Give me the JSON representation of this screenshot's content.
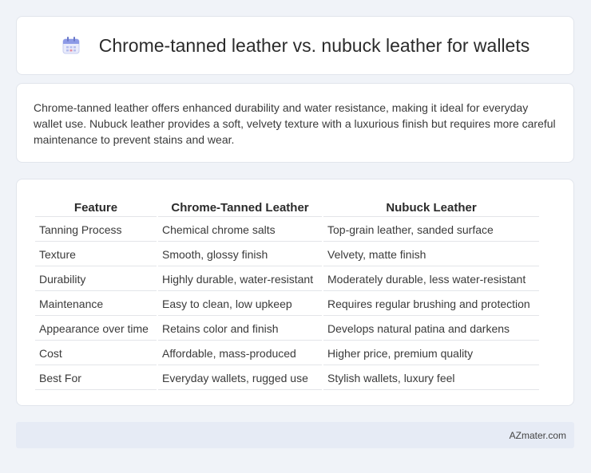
{
  "header": {
    "title": "Chrome-tanned leather vs. nubuck leather for wallets",
    "icon": "calendar-icon"
  },
  "description": "Chrome-tanned leather offers enhanced durability and water resistance, making it ideal for everyday wallet use. Nubuck leather provides a soft, velvety texture with a luxurious finish but requires more careful maintenance to prevent stains and wear.",
  "table": {
    "headers": [
      "Feature",
      "Chrome-Tanned Leather",
      "Nubuck Leather"
    ],
    "rows": [
      [
        "Tanning Process",
        "Chemical chrome salts",
        "Top-grain leather, sanded surface"
      ],
      [
        "Texture",
        "Smooth, glossy finish",
        "Velvety, matte finish"
      ],
      [
        "Durability",
        "Highly durable, water-resistant",
        "Moderately durable, less water-resistant"
      ],
      [
        "Maintenance",
        "Easy to clean, low upkeep",
        "Requires regular brushing and protection"
      ],
      [
        "Appearance over time",
        "Retains color and finish",
        "Develops natural patina and darkens"
      ],
      [
        "Cost",
        "Affordable, mass-produced",
        "Higher price, premium quality"
      ],
      [
        "Best For",
        "Everyday wallets, rugged use",
        "Stylish wallets, luxury feel"
      ]
    ]
  },
  "footer": {
    "brand": "AZmater.com"
  },
  "colors": {
    "background": "#f0f3f8",
    "card": "#ffffff",
    "footer": "#e6ebf5",
    "icon_accent": "#7a8fe0"
  }
}
